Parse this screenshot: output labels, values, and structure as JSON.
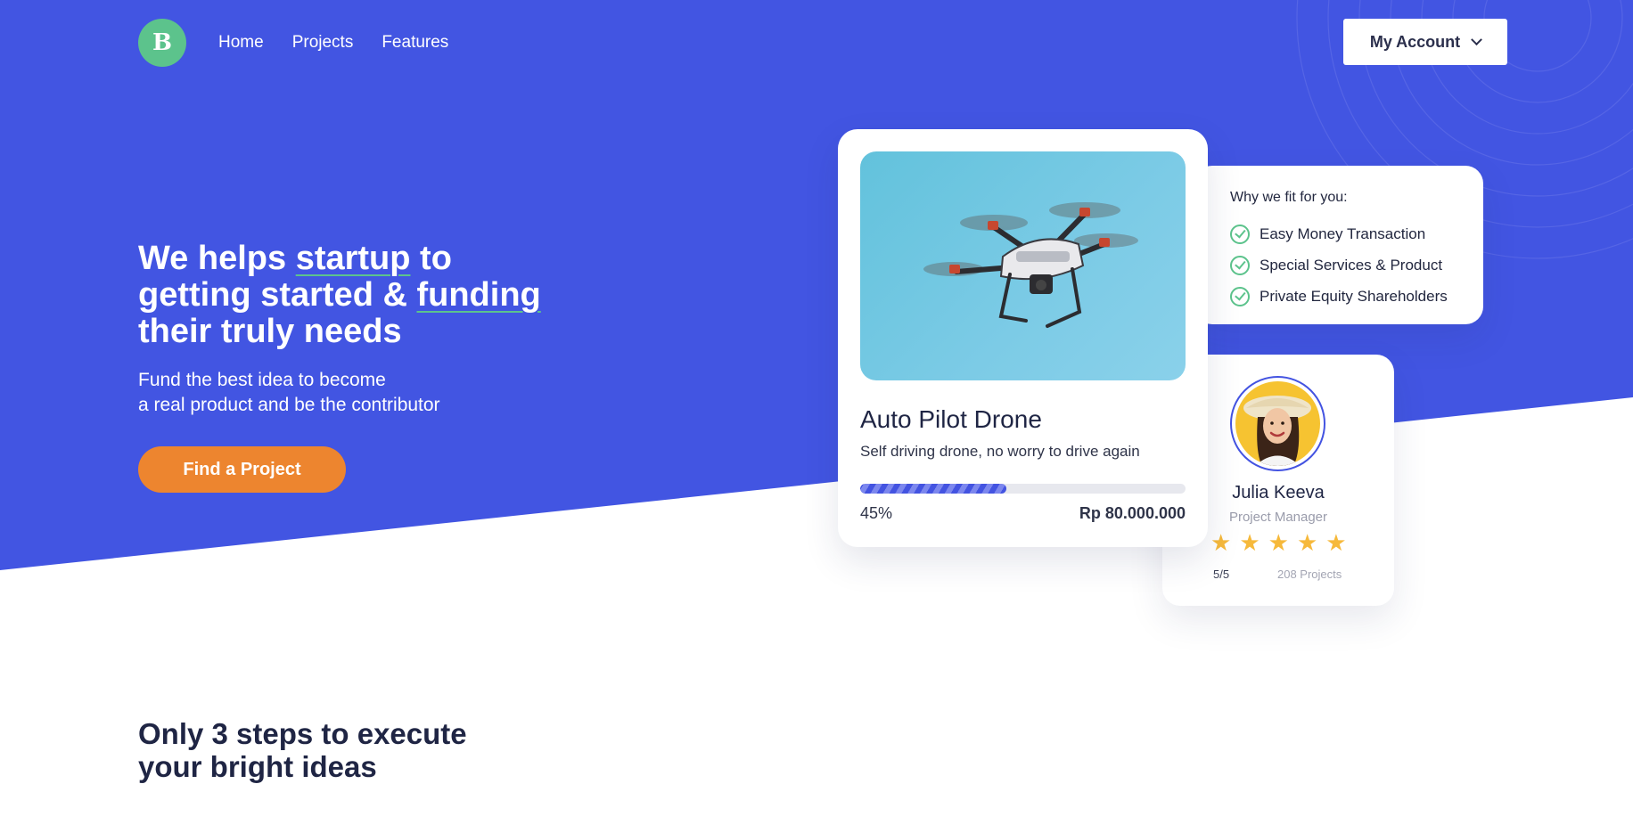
{
  "brand": {
    "logo_letter": "B",
    "primary_color": "#4255e2",
    "accent_green": "#5cc38c",
    "accent_orange": "#ed852f"
  },
  "nav": {
    "links": [
      "Home",
      "Projects",
      "Features"
    ],
    "account_label": "My Account",
    "account_icon": "chevron-down-icon"
  },
  "hero": {
    "title_parts": [
      "We helps ",
      "startup",
      " to",
      "getting started & ",
      "funding",
      "their truly needs"
    ],
    "subtitle_lines": [
      "Fund the best idea to become",
      "a real product and be the contributor"
    ],
    "cta_label": "Find a Project"
  },
  "project_card": {
    "image": "drone-photo",
    "title": "Auto Pilot Drone",
    "description": "Self driving drone, no worry to drive again",
    "progress_percent": 45,
    "progress_label": "45%",
    "amount": "Rp 80.000.000"
  },
  "fit_card": {
    "title": "Why we fit for you:",
    "items": [
      "Easy Money Transaction",
      "Special Services & Product",
      "Private Equity Shareholders"
    ]
  },
  "profile_card": {
    "name": "Julia Keeva",
    "role": "Project Manager",
    "stars": 5,
    "rating": "5/5",
    "projects": "208 Projects"
  },
  "steps": {
    "title_lines": [
      "Only 3 steps to execute",
      "your bright ideas"
    ]
  }
}
